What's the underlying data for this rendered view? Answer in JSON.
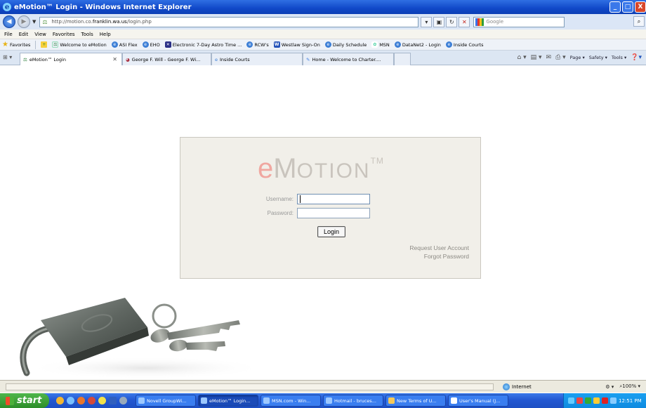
{
  "window": {
    "title": "eMotion™ Login - Windows Internet Explorer",
    "controls": [
      "minimize",
      "maximize",
      "close"
    ]
  },
  "address_bar": {
    "url_prefix": "http://motion.co.",
    "url_domain": "franklin.wa.us",
    "url_path": "/login.php",
    "search_placeholder": "Google"
  },
  "menu": [
    "File",
    "Edit",
    "View",
    "Favorites",
    "Tools",
    "Help"
  ],
  "favorites_bar": {
    "label": "Favorites",
    "items": [
      {
        "label": "Welcome to eMotion",
        "icon": "emotion-icon"
      },
      {
        "label": "ASI Flex",
        "icon": "ie-icon"
      },
      {
        "label": "EHO",
        "icon": "ie-icon"
      },
      {
        "label": "Electronic 7-Day Astro Time ...",
        "icon": "ehx-icon"
      },
      {
        "label": "RCW's",
        "icon": "ie-icon"
      },
      {
        "label": "Westlaw Sign-On",
        "icon": "westlaw-icon"
      },
      {
        "label": "Daily Schedule",
        "icon": "ie-icon"
      },
      {
        "label": "MSN",
        "icon": "msn-icon"
      },
      {
        "label": "DataNet2 - Login",
        "icon": "ie-icon"
      },
      {
        "label": "Inside Courts",
        "icon": "ie-icon"
      }
    ]
  },
  "tabs": [
    {
      "label": "eMotion™ Login",
      "active": true
    },
    {
      "label": "George F. Will - George F. Wi...",
      "active": false
    },
    {
      "label": "Inside Courts",
      "active": false
    },
    {
      "label": "Home - Welcome to Charter....",
      "active": false
    }
  ],
  "command_bar": {
    "page": "Page",
    "safety": "Safety",
    "tools": "Tools"
  },
  "login": {
    "logo_e": "e",
    "logo_m": "M",
    "logo_rest": "OTION",
    "logo_tm": "TM",
    "username_label": "Username:",
    "username_value": "",
    "password_label": "Password:",
    "password_value": "",
    "button": "Login",
    "link_request": "Request User Account",
    "link_forgot": "Forgot Password"
  },
  "status_bar": {
    "zone": "Internet",
    "zoom": "100%"
  },
  "taskbar": {
    "start": "start",
    "tasks": [
      {
        "label": "Novell GroupWi...",
        "active": false
      },
      {
        "label": "eMotion™ Login...",
        "active": true
      },
      {
        "label": "MSN.com - Win...",
        "active": false
      },
      {
        "label": "Hotmail - bruces...",
        "active": false
      },
      {
        "label": "New Terms of U...",
        "active": false
      },
      {
        "label": "User's Manual (J...",
        "active": false
      }
    ],
    "clock": "12:51 PM"
  }
}
